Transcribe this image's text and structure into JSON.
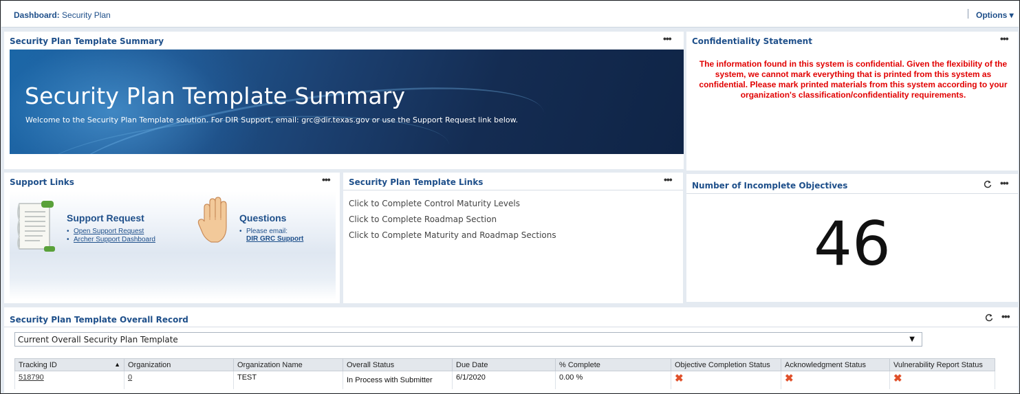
{
  "topbar": {
    "dashboard_label": "Dashboard:",
    "dashboard_name": "Security Plan",
    "options_label": "Options ▾"
  },
  "summary_panel": {
    "title": "Security Plan Template Summary",
    "more": "•••",
    "banner_title": "Security Plan Template Summary",
    "banner_subtitle": "Welcome to the Security Plan Template solution. For DIR Support, email: grc@dir.texas.gov or use the Support Request link below."
  },
  "confidentiality_panel": {
    "title": "Confidentiality Statement",
    "more": "•••",
    "text": "The information found in this system is confidential. Given the flexibility of the system, we cannot mark everything that is printed from this system as confidential. Please mark printed materials from this system according to your organization's classification/confidentiality requirements."
  },
  "support_panel": {
    "title": "Support Links",
    "more": "•••",
    "request_heading": "Support Request",
    "request_links": [
      "Open Support Request",
      "Archer Support Dashboard"
    ],
    "questions_heading": "Questions",
    "questions_text": "Please email:",
    "questions_link": "DIR GRC Support"
  },
  "template_links_panel": {
    "title": "Security Plan Template Links",
    "more": "•••",
    "links": [
      "Click to Complete Control Maturity Levels",
      "Click to Complete Roadmap Section",
      "Click to Complete Maturity and Roadmap Sections"
    ]
  },
  "objectives_panel": {
    "title": "Number of Incomplete Objectives",
    "more": "•••",
    "value": "46"
  },
  "overall_panel": {
    "title": "Security Plan Template Overall Record",
    "more": "•••",
    "select_value": "Current Overall Security Plan Template",
    "columns": [
      "Tracking ID",
      "Organization",
      "Organization Name",
      "Overall Status",
      "Due Date",
      "% Complete",
      "Objective Completion Status",
      "Acknowledgment Status",
      "Vulnerability Report Status"
    ],
    "rows": [
      {
        "tracking_id": "518790",
        "organization": "0",
        "organization_name": "TEST",
        "overall_status": "In Process with Submitter",
        "due_date": "6/1/2020",
        "percent_complete": "0.00 %",
        "objective_completion_status": "✖",
        "acknowledgment_status": "✖",
        "vulnerability_report_status": "✖"
      }
    ]
  },
  "colors": {
    "accent": "#1e4f8a",
    "warning_text": "#e10000",
    "status_x": "#e0502a",
    "banner_dark": "#0f2446"
  }
}
